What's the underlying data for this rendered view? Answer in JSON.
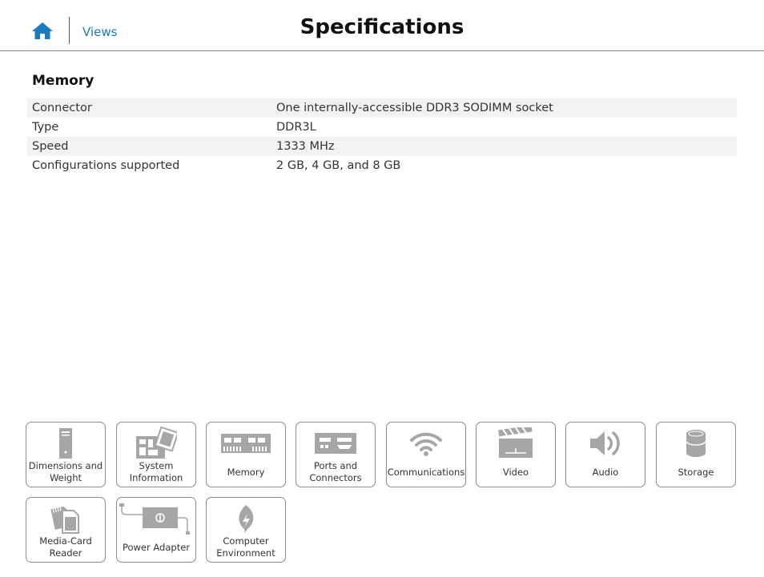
{
  "header": {
    "views_label": "Views",
    "title": "Specifications"
  },
  "memory": {
    "heading": "Memory",
    "rows": [
      {
        "key": "Connector",
        "value": "One internally-accessible DDR3 SODIMM socket"
      },
      {
        "key": "Type",
        "value": "DDR3L"
      },
      {
        "key": "Speed",
        "value": "1333 MHz"
      },
      {
        "key": "Configurations supported",
        "value": "2 GB, 4 GB, and 8 GB"
      }
    ]
  },
  "tiles": [
    {
      "label": "Dimensions and Weight",
      "icon": "tower-icon"
    },
    {
      "label": "System Information",
      "icon": "system-board-icon"
    },
    {
      "label": "Memory",
      "icon": "memory-module-icon"
    },
    {
      "label": "Ports and Connectors",
      "icon": "ports-icon"
    },
    {
      "label": "Communications",
      "icon": "wifi-icon"
    },
    {
      "label": "Video",
      "icon": "clapperboard-icon"
    },
    {
      "label": "Audio",
      "icon": "speaker-icon"
    },
    {
      "label": "Storage",
      "icon": "disk-icon"
    },
    {
      "label": "Media-Card Reader",
      "icon": "media-card-icon"
    },
    {
      "label": "Power Adapter",
      "icon": "power-adapter-icon"
    },
    {
      "label": "Computer Environment",
      "icon": "leaf-icon"
    }
  ],
  "colors": {
    "link": "#1a7bbf",
    "icon_gray": "#a6a6a6",
    "row_alt": "#f3f3f3"
  }
}
